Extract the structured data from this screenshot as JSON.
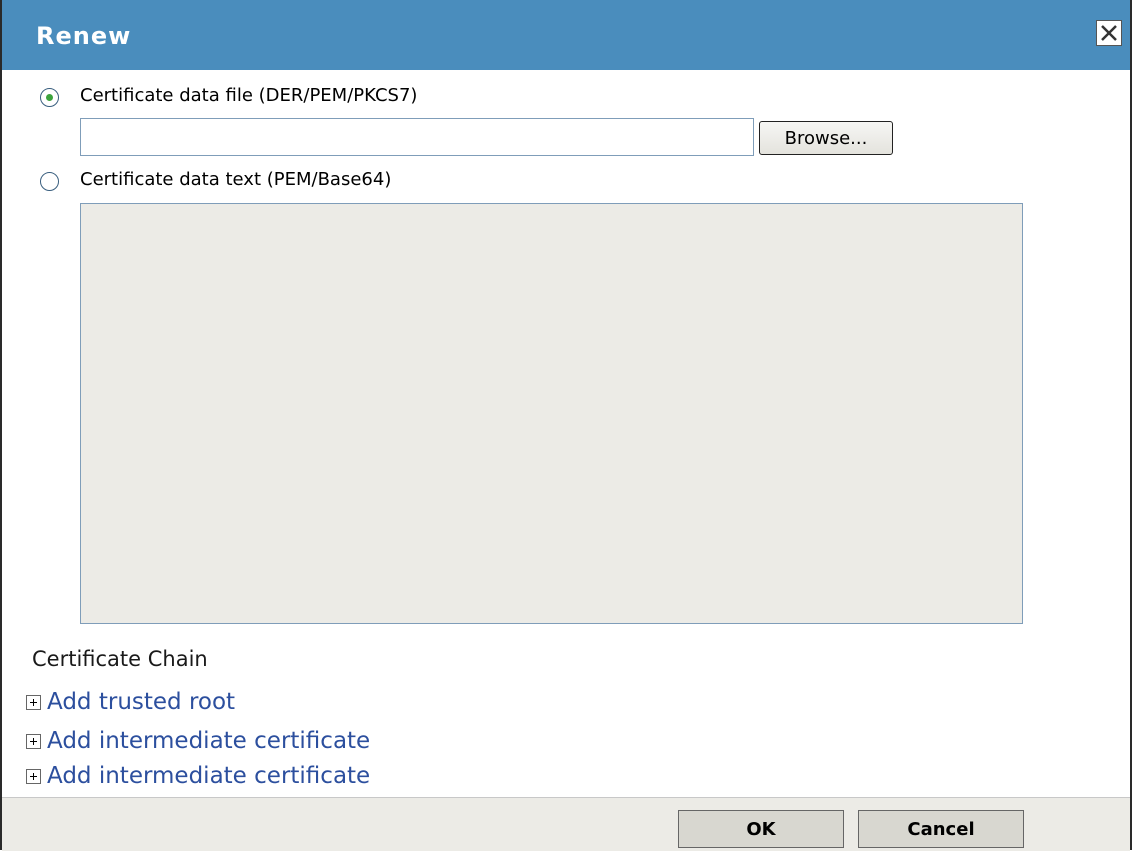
{
  "dialog": {
    "title": "Renew",
    "close_icon": "close-icon"
  },
  "options": {
    "file_option": {
      "label": "Certificate data file (DER/PEM/PKCS7)",
      "selected": true
    },
    "file_input": {
      "value": "",
      "placeholder": ""
    },
    "browse_label": "Browse...",
    "text_option": {
      "label": "Certificate data text (PEM/Base64)",
      "selected": false
    },
    "text_area": {
      "value": ""
    }
  },
  "chain": {
    "title": "Certificate Chain",
    "items": [
      {
        "label": "Add trusted root",
        "icon": "expand-plus-icon"
      },
      {
        "label": "Add intermediate certificate",
        "icon": "expand-plus-icon"
      },
      {
        "label": "Add intermediate certificate",
        "icon": "expand-plus-icon"
      }
    ]
  },
  "footer": {
    "ok_label": "OK",
    "cancel_label": "Cancel"
  },
  "colors": {
    "titlebar": "#4a8dbd",
    "link": "#2c4f9e",
    "radio_selected": "#3da33d",
    "textarea_bg": "#ecebe6"
  }
}
